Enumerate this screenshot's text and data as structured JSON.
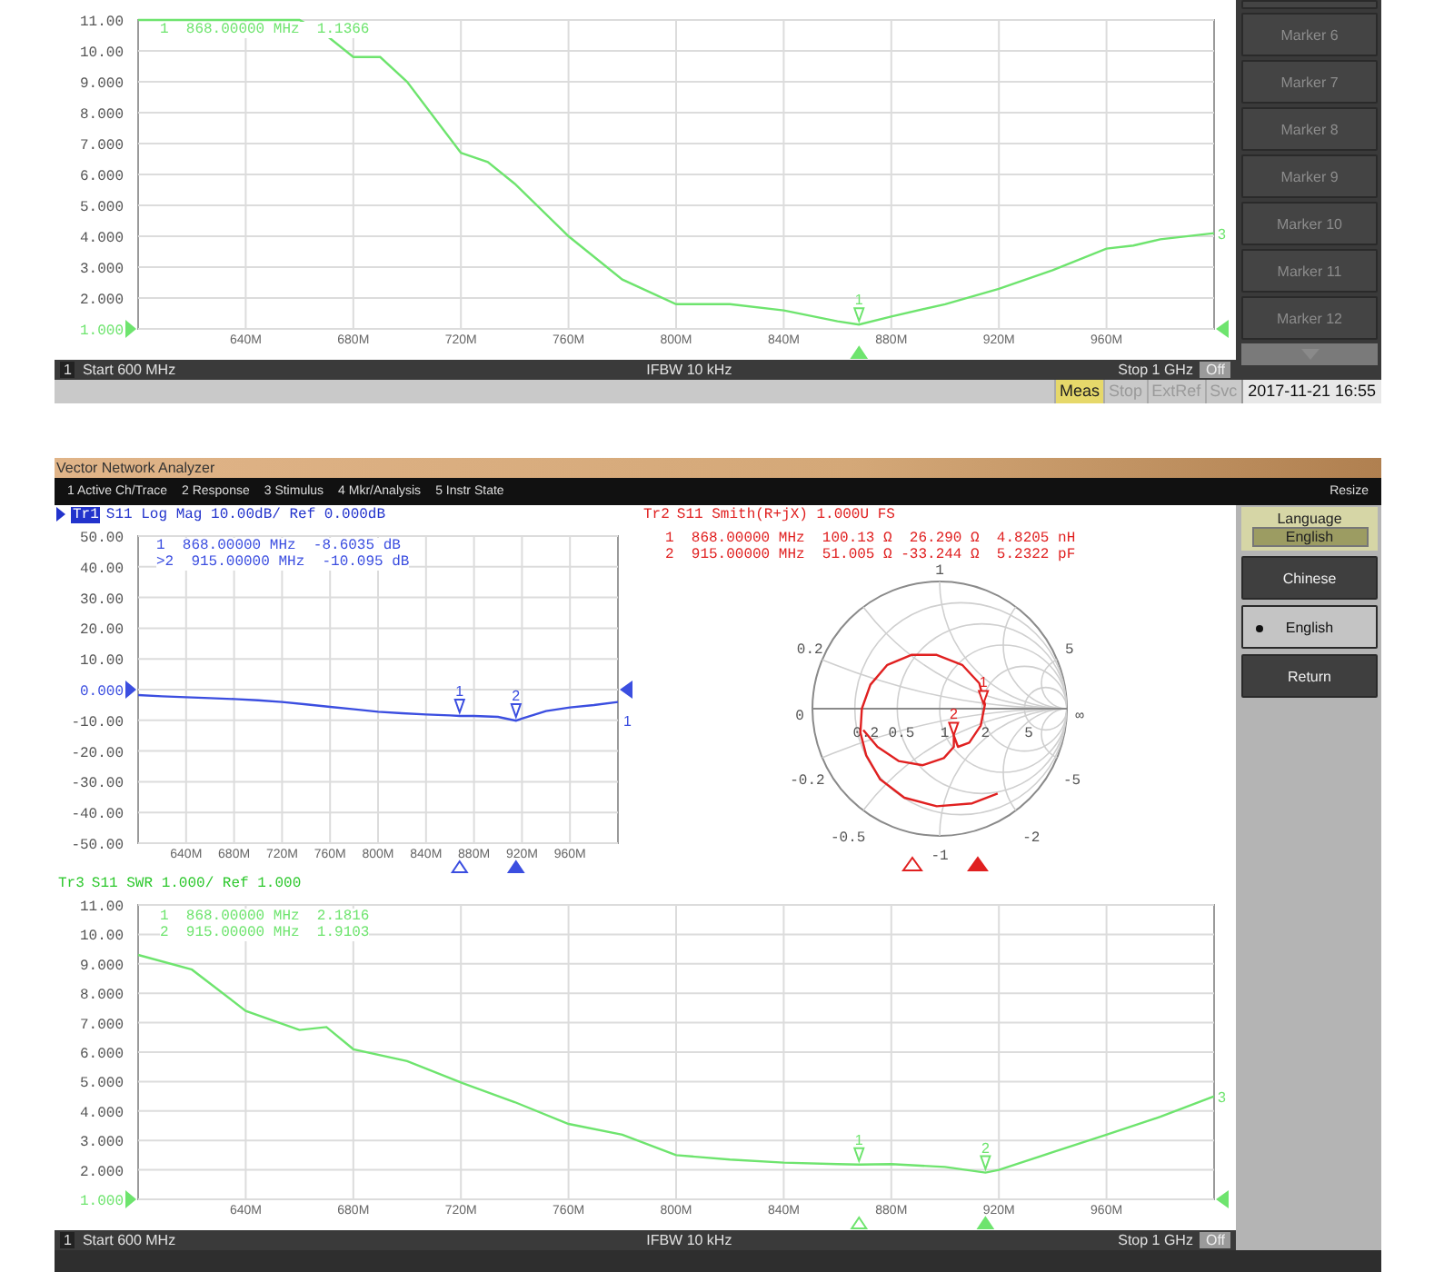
{
  "top_window": {
    "swr_chart": {
      "markers": [
        "1  868.00000 MHz  1.1366"
      ],
      "trace_end_label": "3",
      "marker_arrows": [
        {
          "active": true
        }
      ],
      "chart_data": {
        "type": "line",
        "grid": true,
        "xlim": [
          600,
          1000
        ],
        "ylim": [
          1,
          11
        ],
        "xticks": [
          {
            "value": 640,
            "label": "640M"
          },
          {
            "value": 680,
            "label": "680M"
          },
          {
            "value": 720,
            "label": "720M"
          },
          {
            "value": 760,
            "label": "760M"
          },
          {
            "value": 800,
            "label": "800M"
          },
          {
            "value": 840,
            "label": "840M"
          },
          {
            "value": 880,
            "label": "880M"
          },
          {
            "value": 920,
            "label": "920M"
          },
          {
            "value": 960,
            "label": "960M"
          }
        ],
        "yticks": [
          {
            "value": 11,
            "label": "11.00"
          },
          {
            "value": 10,
            "label": "10.00"
          },
          {
            "value": 9,
            "label": "9.000"
          },
          {
            "value": 8,
            "label": "8.000"
          },
          {
            "value": 7,
            "label": "7.000"
          },
          {
            "value": 6,
            "label": "6.000"
          },
          {
            "value": 5,
            "label": "5.000"
          },
          {
            "value": 4,
            "label": "4.000"
          },
          {
            "value": 3,
            "label": "3.000"
          },
          {
            "value": 2,
            "label": "2.000"
          },
          {
            "value": 1,
            "label": "1.000"
          }
        ],
        "x": [
          600,
          620,
          640,
          660,
          670,
          680,
          690,
          700,
          720,
          730,
          740,
          760,
          780,
          800,
          820,
          840,
          860,
          868,
          880,
          900,
          920,
          940,
          960,
          970,
          980,
          1000
        ],
        "series": [
          {
            "color": "#6ee46e",
            "values": [
              11,
              11,
              11,
              11,
              10.5,
              9.8,
              9.8,
              9.0,
              6.7,
              6.4,
              5.7,
              4.0,
              2.6,
              1.8,
              1.8,
              1.6,
              1.25,
              1.14,
              1.4,
              1.8,
              2.3,
              2.9,
              3.6,
              3.7,
              3.9,
              4.1
            ]
          }
        ],
        "annotations": [
          {
            "x": 868,
            "y": 1.1366,
            "text": "1"
          }
        ]
      }
    },
    "footer": {
      "channel": "1",
      "start": "Start 600 MHz",
      "ifbw": "IFBW 10 kHz",
      "stop": "Stop 1 GHz",
      "off_button": "Off"
    },
    "softkeys": [
      "Marker 6",
      "Marker 7",
      "Marker 8",
      "Marker 9",
      "Marker 10",
      "Marker 11",
      "Marker 12"
    ],
    "status_bar": {
      "items": [
        {
          "label": "Meas",
          "active": true
        },
        {
          "label": "Stop",
          "active": false
        },
        {
          "label": "ExtRef",
          "active": false
        },
        {
          "label": "Svc",
          "active": false
        }
      ],
      "datetime": "2017-11-21 16:55"
    }
  },
  "bottom_window": {
    "title": "Vector Network Analyzer",
    "menu": [
      "1 Active Ch/Trace",
      "2 Response",
      "3 Stimulus",
      "4 Mkr/Analysis",
      "5 Instr State"
    ],
    "resize": "Resize",
    "log_mag_chart": {
      "header": {
        "active": true,
        "text": "S11 Log Mag 10.00dB/ Ref 0.000dB"
      },
      "markers": [
        "1  868.00000 MHz  -8.6035 dB",
        ">2  915.00000 MHz  -10.095 dB"
      ],
      "trace_end_label": "1",
      "marker_arrows": [
        {
          "active": false
        },
        {
          "active": true
        }
      ],
      "chart_data": {
        "type": "line",
        "grid": true,
        "xlim": [
          600,
          1000
        ],
        "ylim": [
          -50,
          50
        ],
        "xticks": [
          {
            "value": 640,
            "label": "640M"
          },
          {
            "value": 680,
            "label": "680M"
          },
          {
            "value": 720,
            "label": "720M"
          },
          {
            "value": 760,
            "label": "760M"
          },
          {
            "value": 800,
            "label": "800M"
          },
          {
            "value": 840,
            "label": "840M"
          },
          {
            "value": 880,
            "label": "880M"
          },
          {
            "value": 920,
            "label": "920M"
          },
          {
            "value": 960,
            "label": "960M"
          }
        ],
        "yticks": [
          {
            "value": 50,
            "label": "50.00"
          },
          {
            "value": 40,
            "label": "40.00"
          },
          {
            "value": 30,
            "label": "30.00"
          },
          {
            "value": 20,
            "label": "20.00"
          },
          {
            "value": 10,
            "label": "10.00"
          },
          {
            "value": 0,
            "label": "0.000"
          },
          {
            "value": -10,
            "label": "-10.00"
          },
          {
            "value": -20,
            "label": "-20.00"
          },
          {
            "value": -30,
            "label": "-30.00"
          },
          {
            "value": -40,
            "label": "-40.00"
          },
          {
            "value": -50,
            "label": "-50.00"
          }
        ],
        "x": [
          600,
          620,
          640,
          660,
          680,
          700,
          720,
          740,
          760,
          780,
          800,
          820,
          840,
          860,
          868,
          880,
          900,
          915,
          920,
          940,
          960,
          980,
          1000
        ],
        "series": [
          {
            "name": "Tr1",
            "color": "#3b4ee0",
            "values": [
              -1.8,
              -2.2,
              -2.5,
              -2.8,
              -3.1,
              -3.5,
              -4,
              -4.8,
              -5.6,
              -6.4,
              -7.2,
              -7.7,
              -8.1,
              -8.4,
              -8.6,
              -8.6,
              -8.9,
              -10.1,
              -9.4,
              -7.0,
              -5.8,
              -5.0,
              -4.0
            ]
          }
        ],
        "annotations": [
          {
            "x": 868,
            "y": -8.6035,
            "text": "1"
          },
          {
            "x": 915,
            "y": -10.095,
            "text": "2"
          }
        ]
      }
    },
    "smith_chart": {
      "header": {
        "trace": "Tr2",
        "active": false,
        "text": "S11 Smith(R+jX) 1.000U FS"
      },
      "markers": [
        "1  868.00000 MHz  100.13 Ω  26.290 Ω  4.8205 nH",
        "2  915.00000 MHz  51.005 Ω -33.244 Ω  5.2322 pF"
      ],
      "grid_labels": [
        "1",
        "0.2",
        "5",
        "0",
        "0.2",
        "0.5",
        "1",
        "2",
        "5",
        "∞",
        "-0.2",
        "-5",
        "-0.5",
        "-1",
        "-2"
      ],
      "trace_markers": [
        {
          "label": "1",
          "active": false
        },
        {
          "label": "2",
          "active": true
        }
      ]
    },
    "swr_chart": {
      "header": {
        "active": false,
        "text": "S11 SWR 1.000/ Ref 1.000"
      },
      "markers": [
        "1  868.00000 MHz  2.1816",
        "2  915.00000 MHz  1.9103"
      ],
      "trace_end_label": "3",
      "marker_arrows": [
        {
          "active": false
        },
        {
          "active": true
        }
      ],
      "chart_data": {
        "type": "line",
        "grid": true,
        "xlim": [
          600,
          1000
        ],
        "ylim": [
          1,
          11
        ],
        "xticks": [
          {
            "value": 640,
            "label": "640M"
          },
          {
            "value": 680,
            "label": "680M"
          },
          {
            "value": 720,
            "label": "720M"
          },
          {
            "value": 760,
            "label": "760M"
          },
          {
            "value": 800,
            "label": "800M"
          },
          {
            "value": 840,
            "label": "840M"
          },
          {
            "value": 880,
            "label": "880M"
          },
          {
            "value": 920,
            "label": "920M"
          },
          {
            "value": 960,
            "label": "960M"
          }
        ],
        "yticks": [
          {
            "value": 11,
            "label": "11.00"
          },
          {
            "value": 10,
            "label": "10.00"
          },
          {
            "value": 9,
            "label": "9.000"
          },
          {
            "value": 8,
            "label": "8.000"
          },
          {
            "value": 7,
            "label": "7.000"
          },
          {
            "value": 6,
            "label": "6.000"
          },
          {
            "value": 5,
            "label": "5.000"
          },
          {
            "value": 4,
            "label": "4.000"
          },
          {
            "value": 3,
            "label": "3.000"
          },
          {
            "value": 2,
            "label": "2.000"
          },
          {
            "value": 1,
            "label": "1.000"
          }
        ],
        "x": [
          600,
          620,
          640,
          660,
          670,
          680,
          700,
          720,
          740,
          760,
          780,
          800,
          820,
          840,
          860,
          868,
          880,
          900,
          915,
          920,
          940,
          960,
          980,
          1000
        ],
        "series": [
          {
            "name": "Tr3",
            "color": "#6ee46e",
            "values": [
              9.3,
              8.8,
              7.4,
              6.75,
              6.85,
              6.1,
              5.7,
              4.97,
              4.3,
              3.56,
              3.2,
              2.5,
              2.35,
              2.25,
              2.2,
              2.18,
              2.2,
              2.1,
              1.91,
              2.0,
              2.6,
              3.2,
              3.8,
              4.5
            ]
          }
        ],
        "annotations": [
          {
            "x": 868,
            "y": 2.1816,
            "text": "1"
          },
          {
            "x": 915,
            "y": 1.9103,
            "text": "2"
          }
        ]
      }
    },
    "footer": {
      "channel": "1",
      "start": "Start 600 MHz",
      "ifbw": "IFBW 10 kHz",
      "stop": "Stop 1 GHz",
      "off_button": "Off"
    },
    "language_menu": {
      "title": "Language",
      "value": "English",
      "items": [
        {
          "kind": "option",
          "label": "Chinese",
          "selected": false
        },
        {
          "kind": "option",
          "label": "English",
          "selected": true
        },
        {
          "kind": "action",
          "label": "Return"
        }
      ]
    }
  }
}
